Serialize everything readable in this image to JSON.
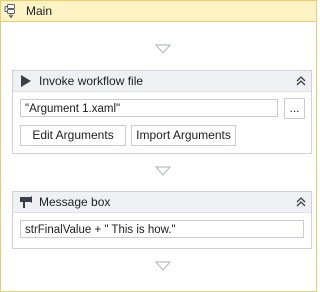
{
  "main": {
    "title": "Main",
    "icon": "sequence-icon"
  },
  "invoke_workflow": {
    "title": "Invoke workflow file",
    "icon": "play-icon",
    "file_value": "\"Argument 1.xaml\"",
    "browse_label": "...",
    "edit_arguments_label": "Edit Arguments",
    "import_arguments_label": "Import Arguments",
    "collapse_icon": "double-chevron-up-icon"
  },
  "message_box": {
    "title": "Message box",
    "icon": "message-box-icon",
    "text_value": "strFinalValue + \" This is how.\"",
    "collapse_icon": "double-chevron-up-icon"
  },
  "colors": {
    "main_header_bg": "#fdf3c4",
    "main_border": "#e6cf6c",
    "activity_header_bg": "#eef0f3",
    "arrow": "#b6bcc6"
  }
}
